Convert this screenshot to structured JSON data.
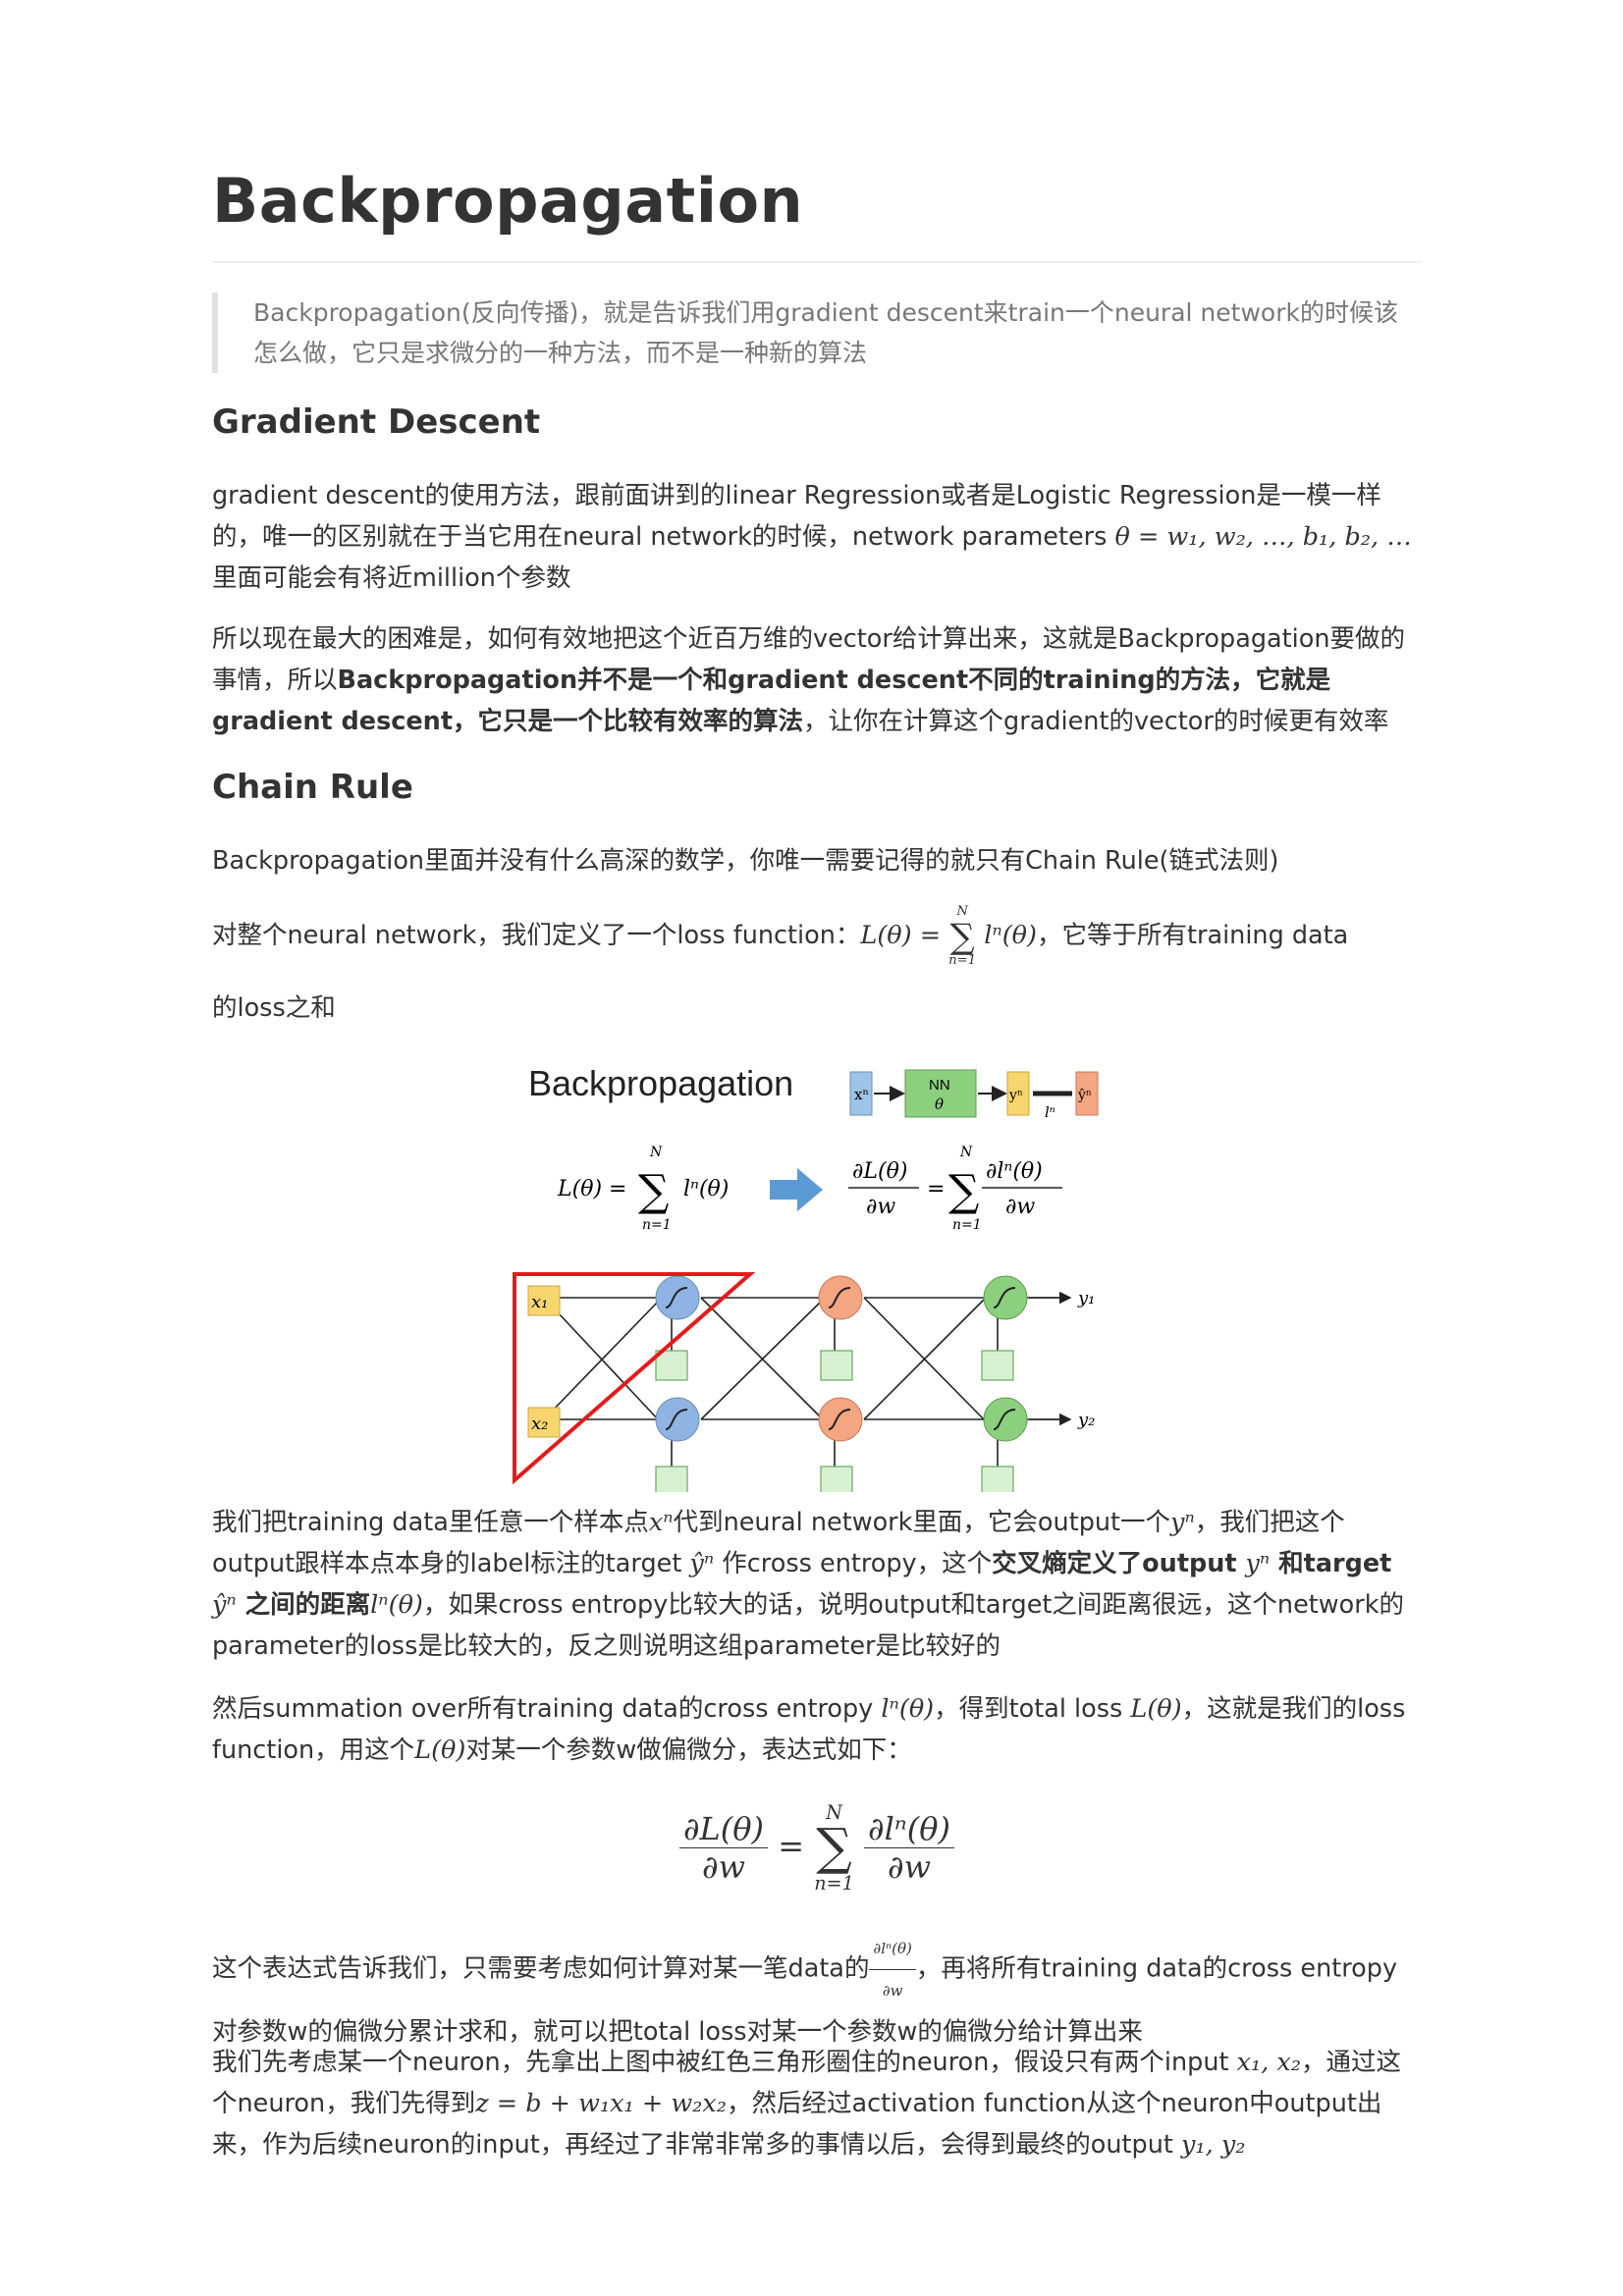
{
  "title": "Backpropagation",
  "quote": "Backpropagation(反向传播)，就是告诉我们用gradient descent来train一个neural network的时候该怎么做，它只是求微分的一种方法，而不是一种新的算法",
  "sections": {
    "gd_heading": "Gradient Descent",
    "gd_p1_a": "gradient descent的使用方法，跟前面讲到的linear Regression或者是Logistic Regression是一模一样的，唯一的区别就在于当它用在neural network的时候，network parameters ",
    "gd_p1_math": "θ = w₁, w₂, …, b₁, b₂, …",
    "gd_p1_b": "里面可能会有将近million个参数",
    "gd_p2_a": "所以现在最大的困难是，如何有效地把这个近百万维的vector给计算出来，这就是Backpropagation要做的事情，所以",
    "gd_p2_bold": "Backpropagation并不是一个和gradient descent不同的training的方法，它就是gradient descent，它只是一个比较有效率的算法",
    "gd_p2_c": "，让你在计算这个gradient的vector的时候更有效率",
    "cr_heading": "Chain Rule",
    "cr_p1": "Backpropagation里面并没有什么高深的数学，你唯一需要记得的就只有Chain Rule(链式法则)",
    "cr_p2_a": "对整个neural network，我们定义了一个loss function：",
    "cr_p2_b": "，它等于所有training data",
    "cr_p2_c": "的loss之和",
    "p3_a": "我们把training data里任意一个样本点",
    "p3_b": "代到neural network里面，它会output一个",
    "p3_c": "，我们把这个output跟样本点本身的label标注的target ",
    "p3_d": " 作cross entropy，这个",
    "p3_bold1": "交叉熵定义了output ",
    "p3_bold2": " 和target",
    "p3_bold3": " 之间的距离",
    "p3_e": "，如果cross entropy比较大的话，说明output和target之间距离很远，这个network的parameter的loss是比较大的，反之则说明这组parameter是比较好的",
    "p4_a": "然后summation over所有training data的cross entropy ",
    "p4_b": "，得到total loss ",
    "p4_c": "，这就是我们的loss function，用这个",
    "p4_d": "对某一个参数w做偏微分，表达式如下：",
    "p5_a": "这个表达式告诉我们，只需要考虑如何计算对某一笔data的",
    "p5_b": "，再将所有training data的cross entropy对参数w的偏微分累计求和，就可以把total loss对某一个参数w的偏微分给计算出来",
    "p6_a": "我们先考虑某一个neuron，先拿出上图中被红色三角形圈住的neuron，假设只有两个input ",
    "p6_b": "，通过这个neuron，我们先得到",
    "p6_c": "，然后经过activation function从这个neuron中output出来，作为后续neuron的input，再经过了非常非常多的事情以后，会得到最终的output "
  },
  "math": {
    "L": "L(θ) =",
    "sum_top": "N",
    "sum_bot": "n=1",
    "sigma": "∑",
    "ln": "lⁿ(θ)",
    "xn": "xⁿ",
    "yn": "yⁿ",
    "yhat": "ŷⁿ",
    "dL": "∂L(θ)",
    "dw": "∂w",
    "eq": "=",
    "dln": "∂lⁿ(θ)",
    "Ltheta": "L(θ)",
    "x1x2": "x₁, x₂",
    "z": "z = b + w₁x₁ + w₂x₂",
    "y1y2": "y₁, y₂"
  },
  "figure": {
    "title": "Backpropagation",
    "box_x": "xⁿ",
    "box_nn": "NN",
    "box_theta": "θ",
    "box_y": "yⁿ",
    "box_yhat": "ŷⁿ",
    "loss_label": "lⁿ",
    "x1": "x₁",
    "x2": "x₂",
    "y1": "y₁",
    "y2": "y₂",
    "colors": {
      "red_triangle": "#e31a1c",
      "blue_neuron": "#8fb4e3",
      "orange_neuron": "#f4a582",
      "green_neuron": "#8ccf7e",
      "input_box": "#f9d56e",
      "arrow": "#5b9bd5"
    }
  }
}
